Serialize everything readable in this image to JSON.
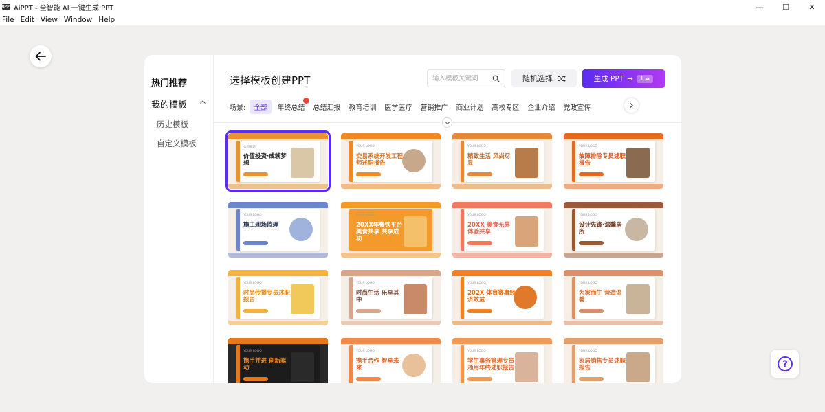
{
  "window": {
    "logo_text": "AiPPT",
    "title": "AiPPT - 全智能 AI 一键生成 PPT",
    "minimize_glyph": "—",
    "maximize_glyph": "☐",
    "close_glyph": "✕"
  },
  "menu": [
    "File",
    "Edit",
    "View",
    "Window",
    "Help"
  ],
  "sidebar": {
    "hot": "热门推荐",
    "mine": "我的模板",
    "sub_items": [
      "历史模板",
      "自定义模板"
    ]
  },
  "main": {
    "title": "选择模板创建PPT",
    "search_placeholder": "输入模板关键词",
    "random_label": "随机选择",
    "generate_label": "生成 PPT",
    "generate_arrow": "→",
    "generate_badge": "1"
  },
  "scene": {
    "label": "场景:",
    "tabs": [
      "全部",
      "年终总结",
      "总结汇报",
      "教育培训",
      "医学医疗",
      "营销推广",
      "商业计划",
      "高校专区",
      "企业介绍",
      "党政宣传"
    ]
  },
  "colors": {
    "accent": "#5b2cf2",
    "accent_end": "#b33af0",
    "hot_dot": "#e84438"
  },
  "templates": [
    {
      "headline": "价值投资·成就梦想",
      "logo": "公司概述",
      "accent": "#e8932f",
      "text_color": "#222222",
      "photo": "#d9c7a8"
    },
    {
      "headline": "交易系统开发工程师述职报告",
      "logo": "YOUR LOGO",
      "accent": "#f08a24",
      "text_color": "#e0731b",
      "photo": "#c7a88a"
    },
    {
      "headline": "精致生活 风尚尽显",
      "logo": "YOUR LOGO",
      "accent": "#e38a3a",
      "text_color": "#c46a26",
      "photo": "#b87b4a"
    },
    {
      "headline": "故障排除专员述职报告",
      "logo": "YOUR LOGO",
      "accent": "#e66a1f",
      "text_color": "#d9561a",
      "photo": "#8a6a50"
    },
    {
      "headline": "施工现场监理",
      "logo": "YOUR LOGO",
      "accent": "#6a86c8",
      "text_color": "#1e2a4a",
      "photo": "#9fb3dd"
    },
    {
      "headline": "20XX年餐饮平台 美食共享 共享成功",
      "logo": "YOUR LOGO",
      "accent": "#f39a2a",
      "text_color": "#ffffff",
      "photo": "#f5c06a"
    },
    {
      "headline": "20XX 美食无界 体验共享",
      "logo": "YOUR LOGO",
      "accent": "#ef7a60",
      "text_color": "#e0604a",
      "photo": "#d9a47a"
    },
    {
      "headline": "设计先锋·温馨居所",
      "logo": "YOUR LOGO",
      "accent": "#9a5a3a",
      "text_color": "#6a3a22",
      "photo": "#c9b6a3"
    },
    {
      "headline": "时尚传播专员述职报告",
      "logo": "YOUR LOGO",
      "accent": "#f3b23a",
      "text_color": "#e58a1a",
      "photo": "#f0c95a"
    },
    {
      "headline": "时尚生活 乐享其中",
      "logo": "YOUR LOGO",
      "accent": "#d9a58a",
      "text_color": "#7a4a3a",
      "photo": "#c98a6a"
    },
    {
      "headline": "202X 体育赛事经济效益",
      "logo": "YOUR LOGO",
      "accent": "#f08020",
      "text_color": "#e56a12",
      "photo": "#e07a2a"
    },
    {
      "headline": "为家而生 营造温馨",
      "logo": "YOUR LOGO",
      "accent": "#d9906a",
      "text_color": "#d0703a",
      "photo": "#c9b49a"
    },
    {
      "headline": "携手并进 创新驱动",
      "logo": "YOUR LOGO",
      "accent": "#e57a1a",
      "text_color": "#f08a2a",
      "photo": "#2a2a2a"
    },
    {
      "headline": "携手合作 智享未来",
      "logo": "YOUR LOGO",
      "accent": "#ef8a4a",
      "text_color": "#d9602a",
      "photo": "#e8c09a"
    },
    {
      "headline": "学生事务管理专员 通用年终述职报告",
      "logo": "YOUR LOGO",
      "accent": "#f09a5a",
      "text_color": "#e06a2a",
      "photo": "#d9b49a"
    },
    {
      "headline": "家居销售专员述职报告",
      "logo": "YOUR LOGO",
      "accent": "#e0a070",
      "text_color": "#d0703a",
      "photo": "#c9a98a"
    }
  ],
  "help_glyph": "?"
}
